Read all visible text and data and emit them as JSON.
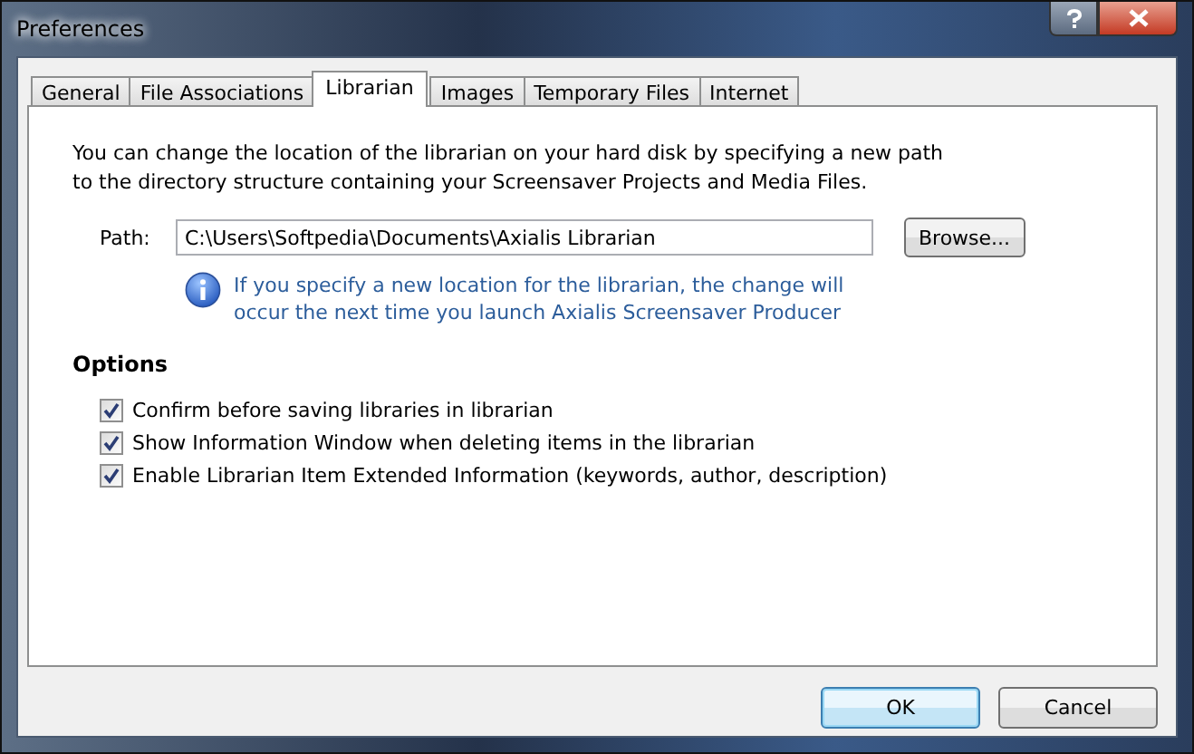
{
  "window": {
    "title": "Preferences"
  },
  "tabs": [
    {
      "label": "General",
      "selected": false
    },
    {
      "label": "File Associations",
      "selected": false
    },
    {
      "label": "Librarian",
      "selected": true
    },
    {
      "label": "Images",
      "selected": false
    },
    {
      "label": "Temporary Files",
      "selected": false
    },
    {
      "label": "Internet",
      "selected": false
    }
  ],
  "description": "You can change the location of the librarian on your hard disk by specifying a new path to the directory structure containing your Screensaver Projects and Media Files.",
  "path": {
    "label": "Path:",
    "value": "C:\\Users\\Softpedia\\Documents\\Axialis Librarian",
    "browse": "Browse..."
  },
  "info": "If you specify a new location for the librarian, the change will occur the next time you launch Axialis Screensaver Producer",
  "options": {
    "title": "Options",
    "items": [
      {
        "label": "Confirm before saving libraries in librarian",
        "checked": true
      },
      {
        "label": "Show Information Window when deleting items in the librarian",
        "checked": true
      },
      {
        "label": "Enable Librarian Item Extended Information (keywords, author, description)",
        "checked": true
      }
    ]
  },
  "buttons": [
    {
      "label": "OK",
      "default": true
    },
    {
      "label": "Cancel",
      "default": false
    }
  ]
}
